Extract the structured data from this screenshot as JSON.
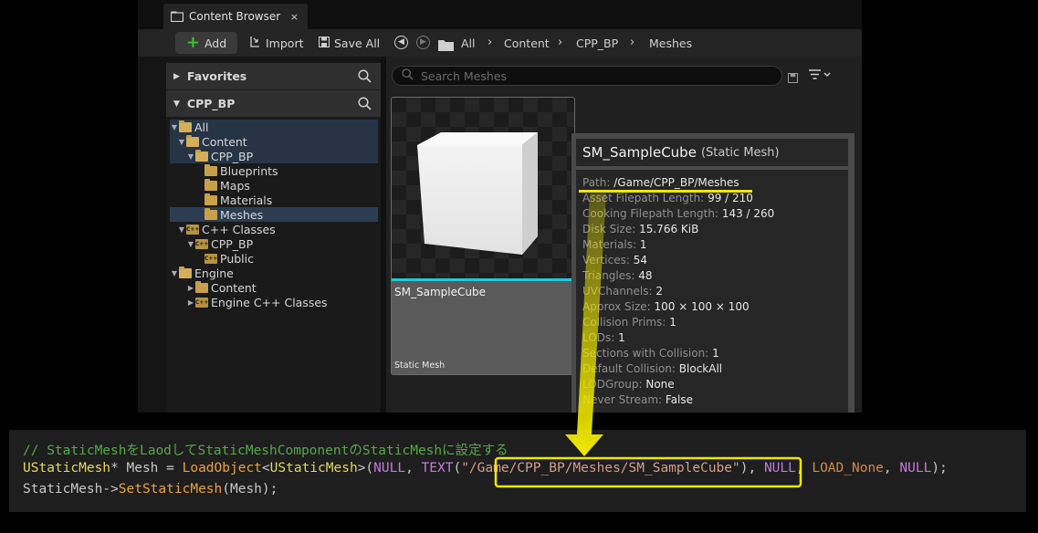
{
  "tab": {
    "label": "Content Browser",
    "close": "×"
  },
  "toolbar": {
    "add_label": "Add",
    "import_label": "Import",
    "save_all_label": "Save All",
    "breadcrumbs": [
      "All",
      "Content",
      "CPP_BP",
      "Meshes"
    ]
  },
  "sidebar": {
    "favorites_label": "Favorites",
    "cpp_bp_label": "CPP_BP",
    "tree": [
      {
        "label": "All",
        "icon": "folder-open-icon",
        "expanded": true
      },
      {
        "label": "Content",
        "icon": "folder-open-icon",
        "expanded": true
      },
      {
        "label": "CPP_BP",
        "icon": "folder-open-icon",
        "expanded": true
      },
      {
        "label": "Blueprints",
        "icon": "folder-icon"
      },
      {
        "label": "Maps",
        "icon": "folder-icon"
      },
      {
        "label": "Materials",
        "icon": "folder-icon"
      },
      {
        "label": "Meshes",
        "icon": "folder-icon",
        "selected": true
      },
      {
        "label": "C++ Classes",
        "icon": "cpp-folder-icon",
        "expanded": true
      },
      {
        "label": "CPP_BP",
        "icon": "cpp-folder-icon",
        "expanded": true
      },
      {
        "label": "Public",
        "icon": "cpp-folder-icon"
      },
      {
        "label": "Engine",
        "icon": "folder-open-icon",
        "expanded": true
      },
      {
        "label": "Content",
        "icon": "folder-icon",
        "expanded": false
      },
      {
        "label": "Engine C++ Classes",
        "icon": "cpp-folder-icon",
        "expanded": false
      }
    ]
  },
  "search": {
    "placeholder": "Search Meshes"
  },
  "asset": {
    "name": "SM_SampleCube",
    "type": "Static Mesh"
  },
  "tooltip": {
    "name": "SM_SampleCube",
    "kind": "(Static Mesh)",
    "rows": [
      {
        "key": "Path:",
        "value": "/Game/CPP_BP/Meshes"
      },
      {
        "key": "Asset Filepath Length:",
        "value": "99 / 210"
      },
      {
        "key": "Cooking Filepath Length:",
        "value": "143 / 260"
      },
      {
        "key": "Disk Size:",
        "value": "15.766 KiB"
      },
      {
        "key": "Materials:",
        "value": "1"
      },
      {
        "key": "Vertices:",
        "value": "54"
      },
      {
        "key": "Triangles:",
        "value": "48"
      },
      {
        "key": "UVChannels:",
        "value": "2"
      },
      {
        "key": "Approx Size:",
        "value": "100 × 100 × 100"
      },
      {
        "key": "Collision Prims:",
        "value": "1"
      },
      {
        "key": "LODs:",
        "value": "1"
      },
      {
        "key": "Sections with Collision:",
        "value": "1"
      },
      {
        "key": "Default Collision:",
        "value": "BlockAll"
      },
      {
        "key": "LODGroup:",
        "value": "None"
      },
      {
        "key": "Never Stream:",
        "value": "False"
      }
    ]
  },
  "code": {
    "comment": "// StaticMeshをLaodしてStaticMeshComponentのStaticMeshに設定する",
    "line2": {
      "type": "UStaticMesh",
      "decl": "* Mesh = ",
      "func": "LoadObject",
      "lt": "<",
      "tparam": "UStaticMesh",
      "gt_paren": ">(",
      "null1": "NULL",
      "comma1": ", ",
      "text_macro": "TEXT",
      "paren_open": "(",
      "string": "\"/Game/CPP_BP/Meshes/SM_SampleCube\"",
      "paren_close": "), ",
      "null2": "NULL",
      "comma2": ", ",
      "load_none": "LOAD_None",
      "comma3": ", ",
      "null3": "NULL",
      "end": ");"
    },
    "line3": {
      "obj": "StaticMesh->",
      "func": "SetStaticMesh",
      "args": "(Mesh);"
    }
  },
  "colors": {
    "highlight_yellow": "#f0e800",
    "selection_cyan": "#1ec8d8"
  }
}
